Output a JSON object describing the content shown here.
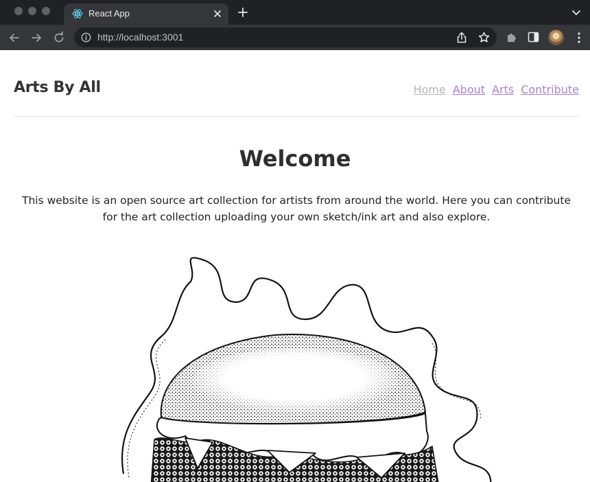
{
  "browser": {
    "tab_title": "React App",
    "url": "http://localhost:3001"
  },
  "site": {
    "brand": "Arts By All",
    "nav": [
      {
        "label": "Home",
        "active": true
      },
      {
        "label": "About"
      },
      {
        "label": "Arts"
      },
      {
        "label": "Contribute"
      }
    ]
  },
  "hero": {
    "title": "Welcome",
    "text": "This website is an open source art collection for artists from around the world. Here you can contribute for the art collection uploading your own sketch/ink art and also explore."
  },
  "artwork": {
    "subject": "ink-sketch-burger-illustration"
  },
  "colors": {
    "chrome_dark": "#202124",
    "chrome_tab": "#35363a",
    "nav_link": "#a77fd8",
    "nav_active": "#b7b7b7",
    "heading": "#2f2f2f"
  }
}
